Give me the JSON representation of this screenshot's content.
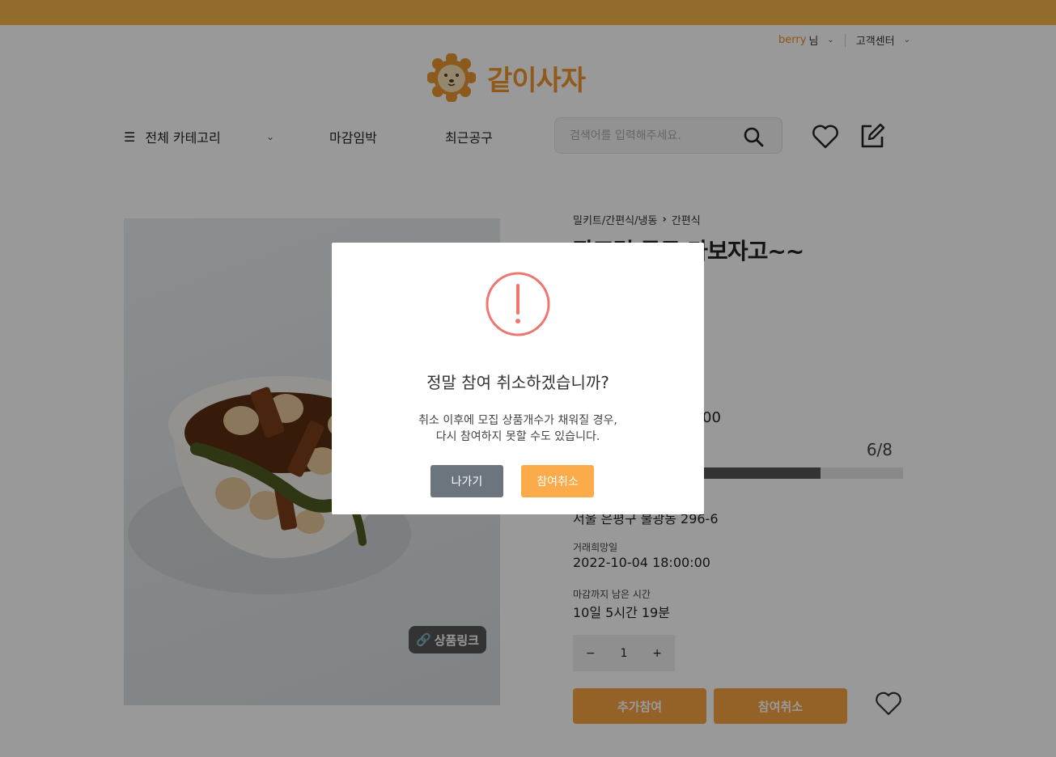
{
  "header": {
    "user_name": "berry",
    "user_suffix": "님",
    "support_label": "고객센터",
    "logo_text": "같이사자"
  },
  "nav": {
    "category_label": "전체 카테고리",
    "link_deadline": "마감임박",
    "link_recent": "최근공구",
    "search_placeholder": "검색어를 입력해주세요."
  },
  "product": {
    "link_badge": "상품링크",
    "breadcrumb": [
      "밀키트/간편식/냉동",
      "간편식"
    ],
    "title_visible": "장조림 공구 가보자고~~",
    "price_fragment": "00",
    "participants": "6/8",
    "progress": 0.75,
    "address": "서울 은평구 불광동 296-6",
    "trade_date_label": "거래희망일",
    "trade_date": "2022-10-04 18:00:00",
    "remaining_label": "마감까지 남은 시간",
    "remaining": "10일 5시간 19분",
    "stepper": {
      "minus": "−",
      "value": "1",
      "plus": "+"
    },
    "join_more_label": "추가참여",
    "cancel_join_label": "참여취소"
  },
  "modal": {
    "title": "정말 참여 취소하겠습니까?",
    "message_line1": "취소 이후에 모집 상품개수가 채워질 경우,",
    "message_line2": "다시 참여하지 못할 수도 있습니다.",
    "exit_label": "나가기",
    "confirm_label": "참여취소"
  },
  "colors": {
    "brand": "#f0982c",
    "banner": "#f6b54a",
    "button_orange": "#f7a241",
    "alert_red": "#f07470",
    "button_gray": "#6c757d"
  },
  "icons": [
    "lion-logo-icon",
    "hamburger-icon",
    "chevron-down-icon",
    "search-icon",
    "heart-icon",
    "edit-icon",
    "link-icon",
    "alert-icon"
  ]
}
